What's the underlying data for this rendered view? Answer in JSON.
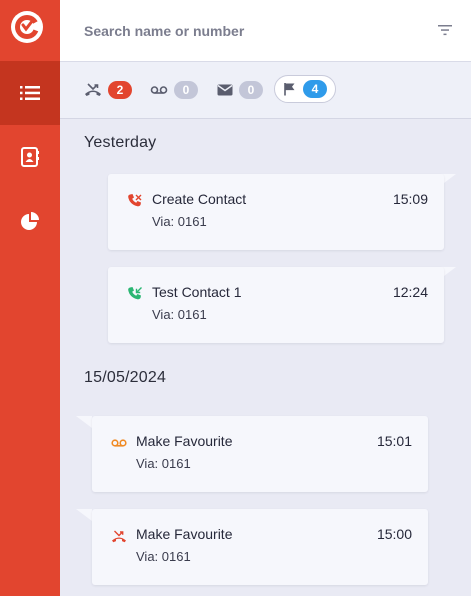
{
  "search": {
    "placeholder": "Search name or number"
  },
  "filters": [
    {
      "icon": "missed-call-icon",
      "count": "2",
      "color": "#e2452f"
    },
    {
      "icon": "voicemail-icon",
      "count": "0",
      "color": "#c3c6d8"
    },
    {
      "icon": "message-icon",
      "count": "0",
      "color": "#c3c6d8"
    },
    {
      "icon": "flag-icon",
      "count": "4",
      "color": "#2f9bea",
      "selected": true
    }
  ],
  "sections": [
    {
      "title": "Yesterday",
      "items": [
        {
          "icon": "outgoing-call-missed-icon",
          "name": "Create Contact",
          "time": "15:09",
          "via": "Via: 0161"
        },
        {
          "icon": "incoming-call-icon",
          "name": "Test Contact 1",
          "time": "12:24",
          "via": "Via: 0161"
        }
      ]
    },
    {
      "title": "15/05/2024",
      "items": [
        {
          "icon": "voicemail-icon",
          "name": "Make Favourite",
          "time": "15:01",
          "via": "Via: 0161"
        },
        {
          "icon": "missed-call-icon",
          "name": "Make Favourite",
          "time": "15:00",
          "via": "Via: 0161"
        }
      ]
    }
  ],
  "colors": {
    "sidebar": "#e2452f",
    "sidebar_active": "#c4351f",
    "missed": "#e2452f",
    "incoming": "#2bb673",
    "voicemail": "#f08a24",
    "flag_badge": "#2f9bea"
  }
}
